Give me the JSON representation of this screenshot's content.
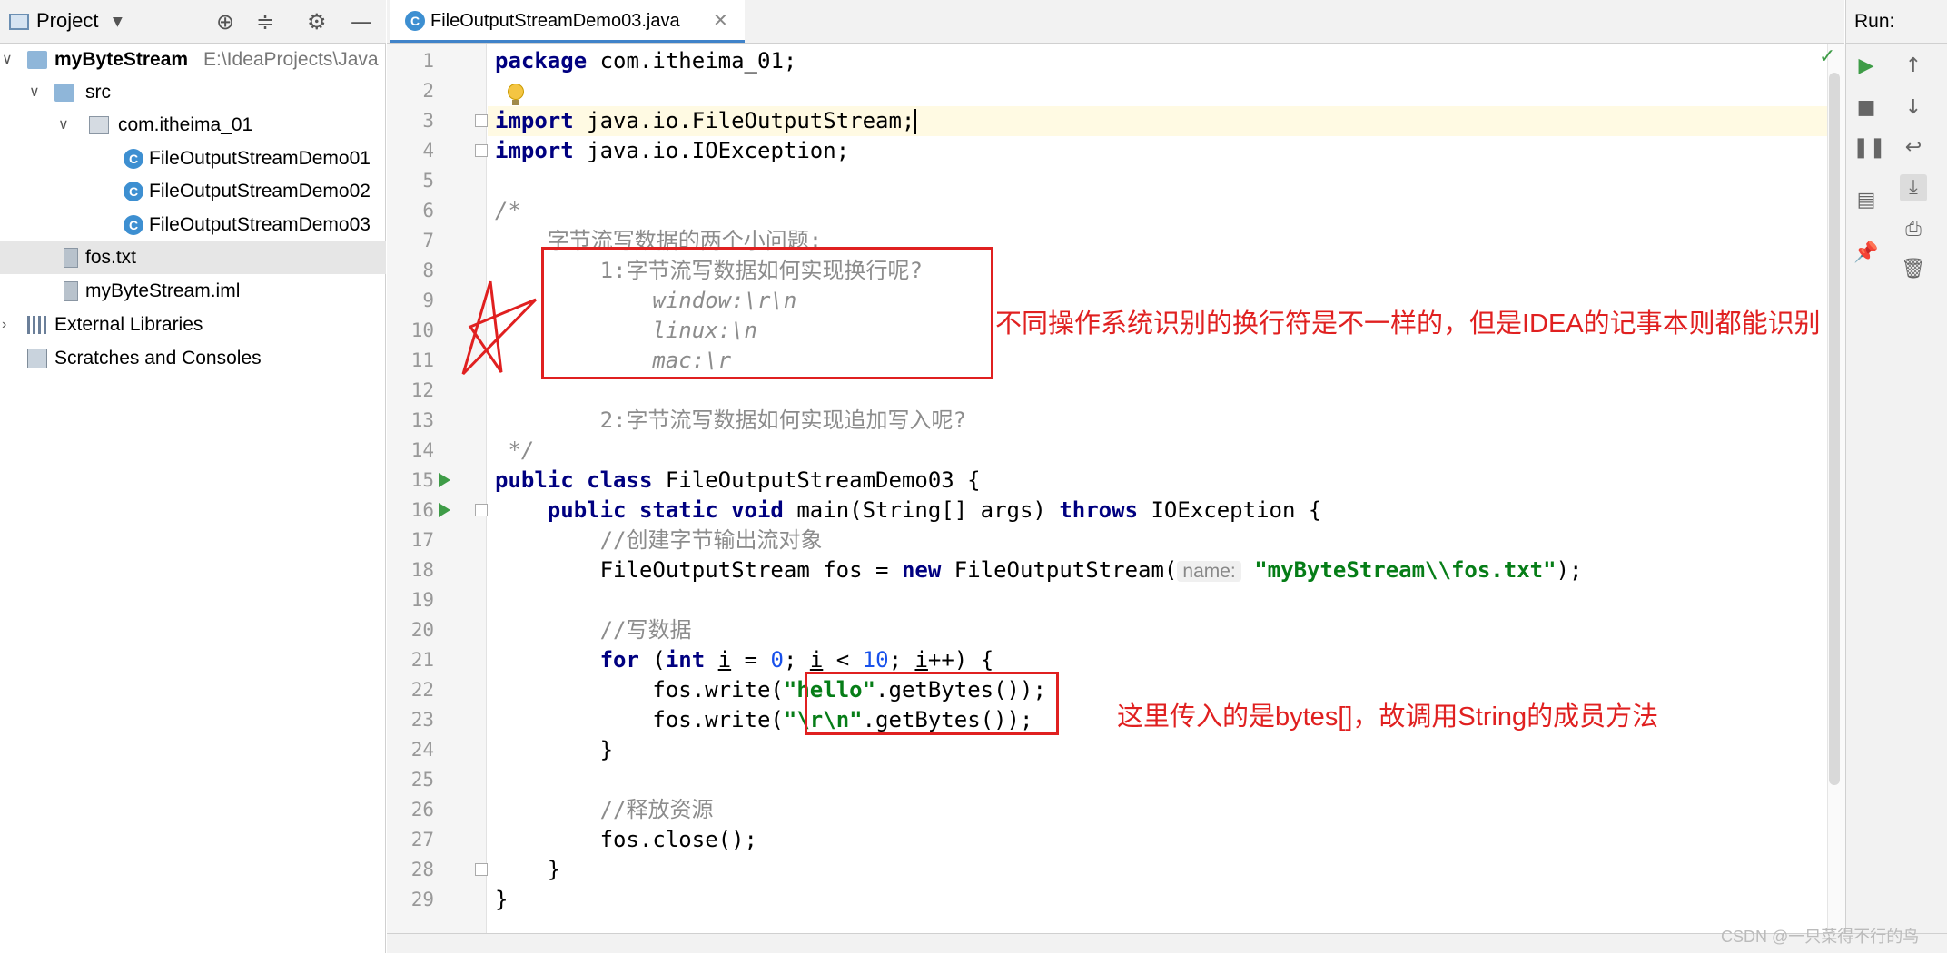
{
  "project_panel": {
    "title": "Project",
    "tree": [
      {
        "label": "myByteStream",
        "path": "E:\\IdeaProjects\\Java"
      },
      {
        "label": "src"
      },
      {
        "label": "com.itheima_01"
      },
      {
        "label": "FileOutputStreamDemo01"
      },
      {
        "label": "FileOutputStreamDemo02"
      },
      {
        "label": "FileOutputStreamDemo03"
      },
      {
        "label": "fos.txt"
      },
      {
        "label": "myByteStream.iml"
      },
      {
        "label": "External Libraries"
      },
      {
        "label": "Scratches and Consoles"
      }
    ]
  },
  "editor": {
    "tab_label": "FileOutputStreamDemo03.java",
    "lines": [
      {
        "n": "1"
      },
      {
        "n": "2"
      },
      {
        "n": "3"
      },
      {
        "n": "4"
      },
      {
        "n": "5"
      },
      {
        "n": "6"
      },
      {
        "n": "7"
      },
      {
        "n": "8"
      },
      {
        "n": "9"
      },
      {
        "n": "10"
      },
      {
        "n": "11"
      },
      {
        "n": "12"
      },
      {
        "n": "13"
      },
      {
        "n": "14"
      },
      {
        "n": "15"
      },
      {
        "n": "16"
      },
      {
        "n": "17"
      },
      {
        "n": "18"
      },
      {
        "n": "19"
      },
      {
        "n": "20"
      },
      {
        "n": "21"
      },
      {
        "n": "22"
      },
      {
        "n": "23"
      },
      {
        "n": "24"
      },
      {
        "n": "25"
      },
      {
        "n": "26"
      },
      {
        "n": "27"
      },
      {
        "n": "28"
      },
      {
        "n": "29"
      }
    ],
    "code": {
      "l1_kw": "package",
      "l1_rest": " com.itheima_01;",
      "l3_kw": "import",
      "l3_rest": " java.io.FileOutputStream;",
      "l4_kw": "import",
      "l4_rest": " java.io.IOException;",
      "l6": "/*",
      "l7": "    字节流写数据的两个小问题:",
      "l8": "        1:字节流写数据如何实现换行呢?",
      "l9": "            window:\\r\\n",
      "l10": "            linux:\\n",
      "l11": "            mac:\\r",
      "l13": "        2:字节流写数据如何实现追加写入呢?",
      "l14": " */",
      "l15_kw": "public class",
      "l15_rest": " FileOutputStreamDemo03 {",
      "l16_kw1": "    public static void",
      "l16_mid": " main(String[] args) ",
      "l16_kw2": "throws",
      "l16_rest": " IOException {",
      "l17": "        //创建字节输出流对象",
      "l18_a": "        FileOutputStream fos = ",
      "l18_kw": "new",
      "l18_b": " FileOutputStream(",
      "l18_hint": "name:",
      "l18_str": "\"myByteStream\\\\fos.txt\"",
      "l18_end": ");",
      "l20": "        //写数据",
      "l21_indent": "        ",
      "l21_kw1": "for",
      "l21_a": " (",
      "l21_kw2": "int",
      "l21_sp": " ",
      "l21_i": "i",
      "l21_b": " = ",
      "l21_n0": "0",
      "l21_c": "; ",
      "l21_i2": "i",
      "l21_d": " < ",
      "l21_n10": "10",
      "l21_e": "; ",
      "l21_i3": "i",
      "l21_f": "++) {",
      "l22_a": "            fos.write(",
      "l22_str": "\"hello\"",
      "l22_b": ".getBytes());",
      "l23_a": "            fos.write(",
      "l23_str": "\"\\r\\n\"",
      "l23_b": ".getBytes());",
      "l24": "        }",
      "l26": "        //释放资源",
      "l27": "        fos.close();",
      "l28": "    }",
      "l29": "}"
    }
  },
  "annotations": {
    "note1": "不同操作系统识别的换行符是不一样的，但是IDEA的记事本则都能识别",
    "note2": "这里传入的是bytes[]，故调用String的成员方法"
  },
  "run_panel": {
    "title": "Run:"
  },
  "watermark": "CSDN @一只菜得不行的鸟",
  "colors": {
    "accent": "#4083c9",
    "annotation": "#e02020",
    "keyword": "#000080",
    "string": "#067d17",
    "comment": "#8c8c8c",
    "number": "#1750eb"
  },
  "icons": [
    "project-view-icon",
    "locate-icon",
    "collapse-icon",
    "gear-icon",
    "minimize-icon",
    "class-icon",
    "folder-icon",
    "package-icon",
    "file-icon",
    "library-icon",
    "scratch-icon",
    "run-icon",
    "stop-icon",
    "pause-icon",
    "soft-wrap-icon",
    "scroll-end-icon",
    "print-icon",
    "delete-icon",
    "pin-icon",
    "layout-icon",
    "up-arrow-icon",
    "down-arrow-icon"
  ]
}
